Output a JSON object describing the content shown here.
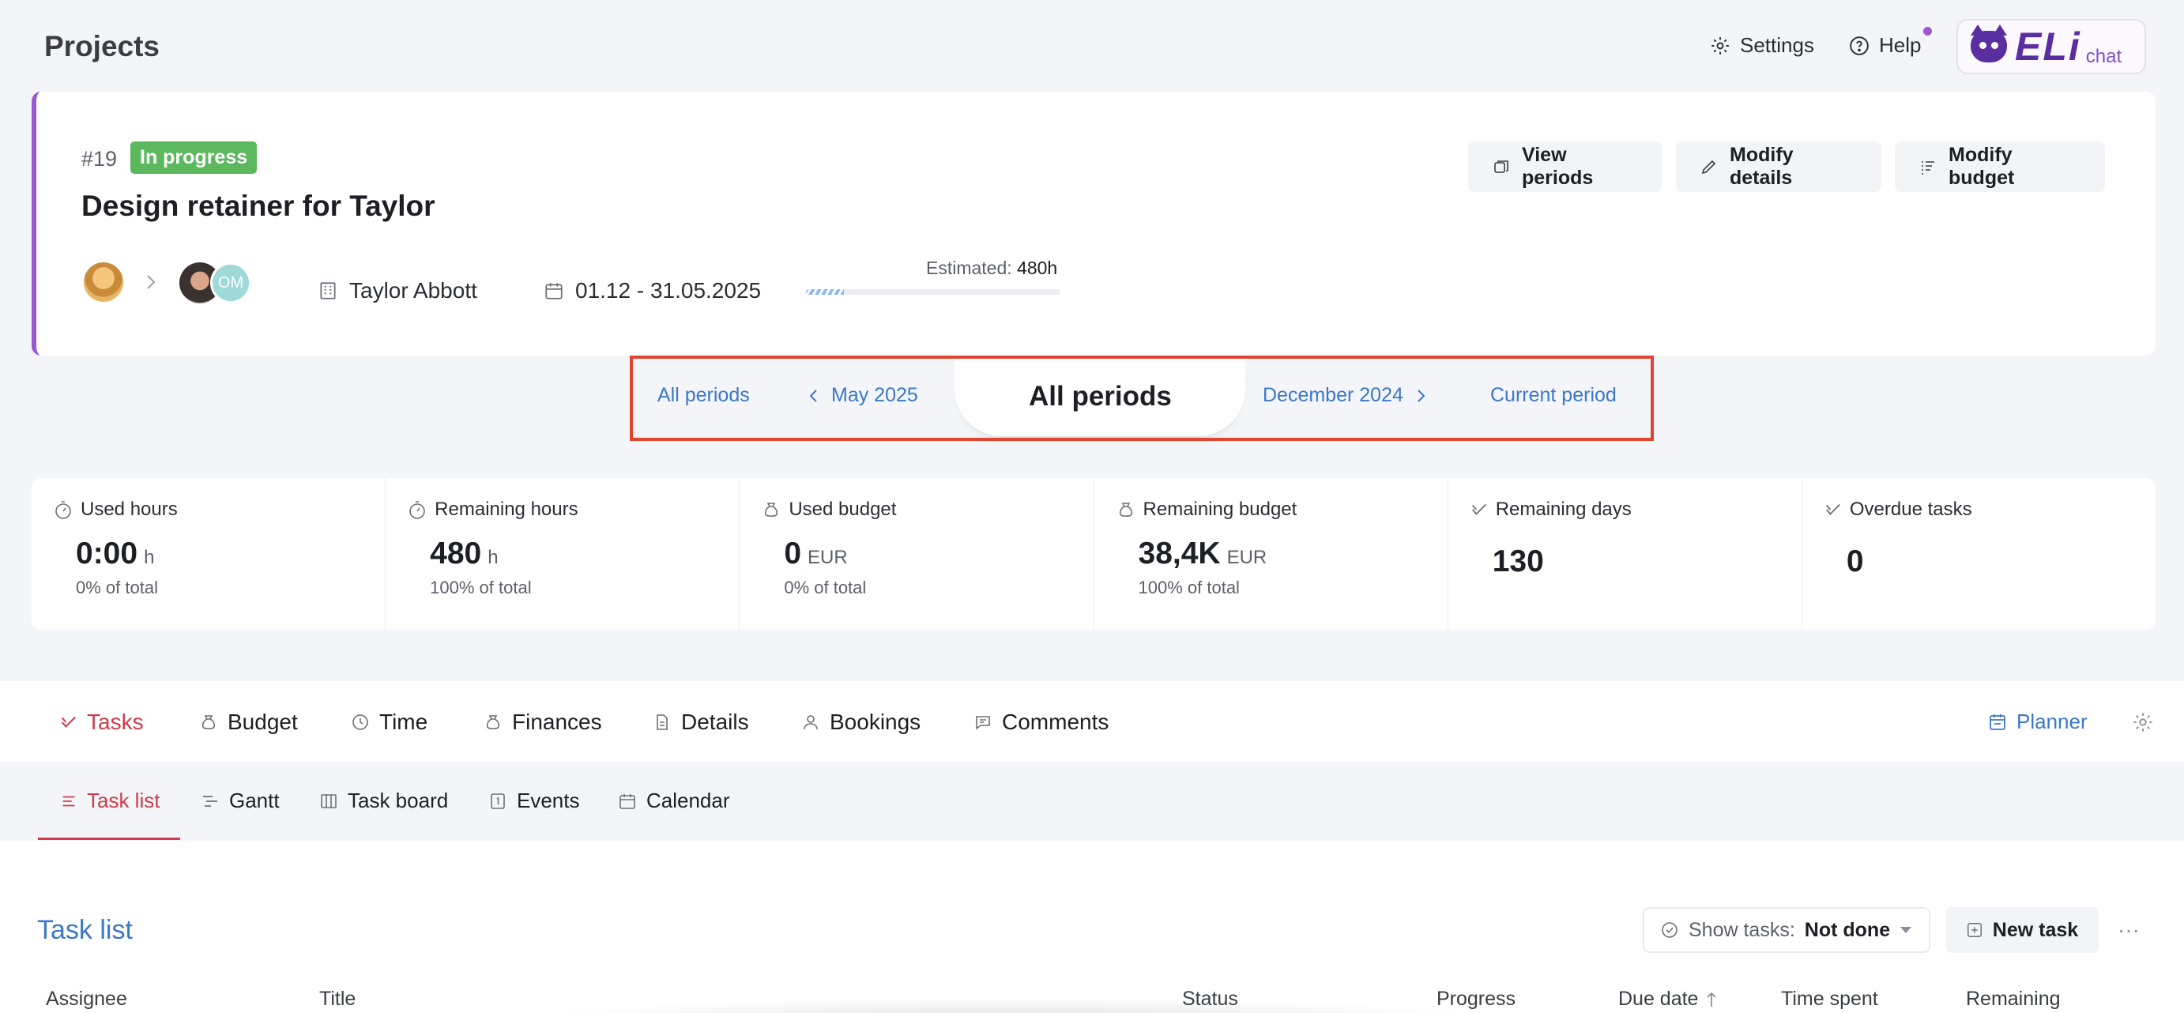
{
  "header": {
    "title": "Projects",
    "settings_label": "Settings",
    "help_label": "Help",
    "eli_brand": "ELi",
    "eli_suffix": "chat"
  },
  "project": {
    "number": "#19",
    "status": "In progress",
    "status_color": "#5cb85c",
    "title": "Design retainer for Taylor",
    "buttons": {
      "view_periods": "View periods",
      "modify_details": "Modify details",
      "modify_budget": "Modify budget"
    },
    "assignee_initials": "OM",
    "client": "Taylor Abbott",
    "dates": "01.12 - 31.05.2025",
    "estimated_label": "Estimated:",
    "estimated_value": "480h",
    "progress_fraction": 0.15
  },
  "periods": {
    "all_periods_link": "All periods",
    "prev_period": "May 2025",
    "current_label": "All periods",
    "next_period": "December 2024",
    "current_period_link": "Current period",
    "highlight_color": "#e2452f"
  },
  "stats": [
    {
      "label": "Used hours",
      "value": "0:00",
      "unit": "h",
      "sub": "0% of total",
      "icon": "stopwatch-icon"
    },
    {
      "label": "Remaining hours",
      "value": "480",
      "unit": "h",
      "sub": "100% of total",
      "icon": "stopwatch-icon"
    },
    {
      "label": "Used budget",
      "value": "0",
      "unit": "EUR",
      "sub": "0% of total",
      "icon": "money-bag-icon"
    },
    {
      "label": "Remaining budget",
      "value": "38,4K",
      "unit": "EUR",
      "sub": "100% of total",
      "icon": "money-bag-icon"
    },
    {
      "label": "Remaining days",
      "value": "130",
      "unit": "",
      "sub": "",
      "icon": "check-icon"
    },
    {
      "label": "Overdue tasks",
      "value": "0",
      "unit": "",
      "sub": "",
      "icon": "check-icon"
    }
  ],
  "tabs": {
    "main": [
      "Tasks",
      "Budget",
      "Time",
      "Finances",
      "Details",
      "Bookings",
      "Comments"
    ],
    "active_main": "Tasks",
    "planner": "Planner",
    "sub": [
      "Task list",
      "Gantt",
      "Task board",
      "Events",
      "Calendar"
    ],
    "active_sub": "Task list"
  },
  "task_list": {
    "title": "Task list",
    "show_tasks_label": "Show tasks:",
    "show_tasks_value": "Not done",
    "new_task": "New task",
    "more": "···",
    "columns": [
      "Assignee",
      "Title",
      "Status",
      "Progress",
      "Due date",
      "Time spent",
      "Remaining"
    ]
  },
  "colors": {
    "accent_blue": "#3a78c9",
    "active_red": "#d03a4b",
    "project_stripe": "#9b59d0"
  }
}
